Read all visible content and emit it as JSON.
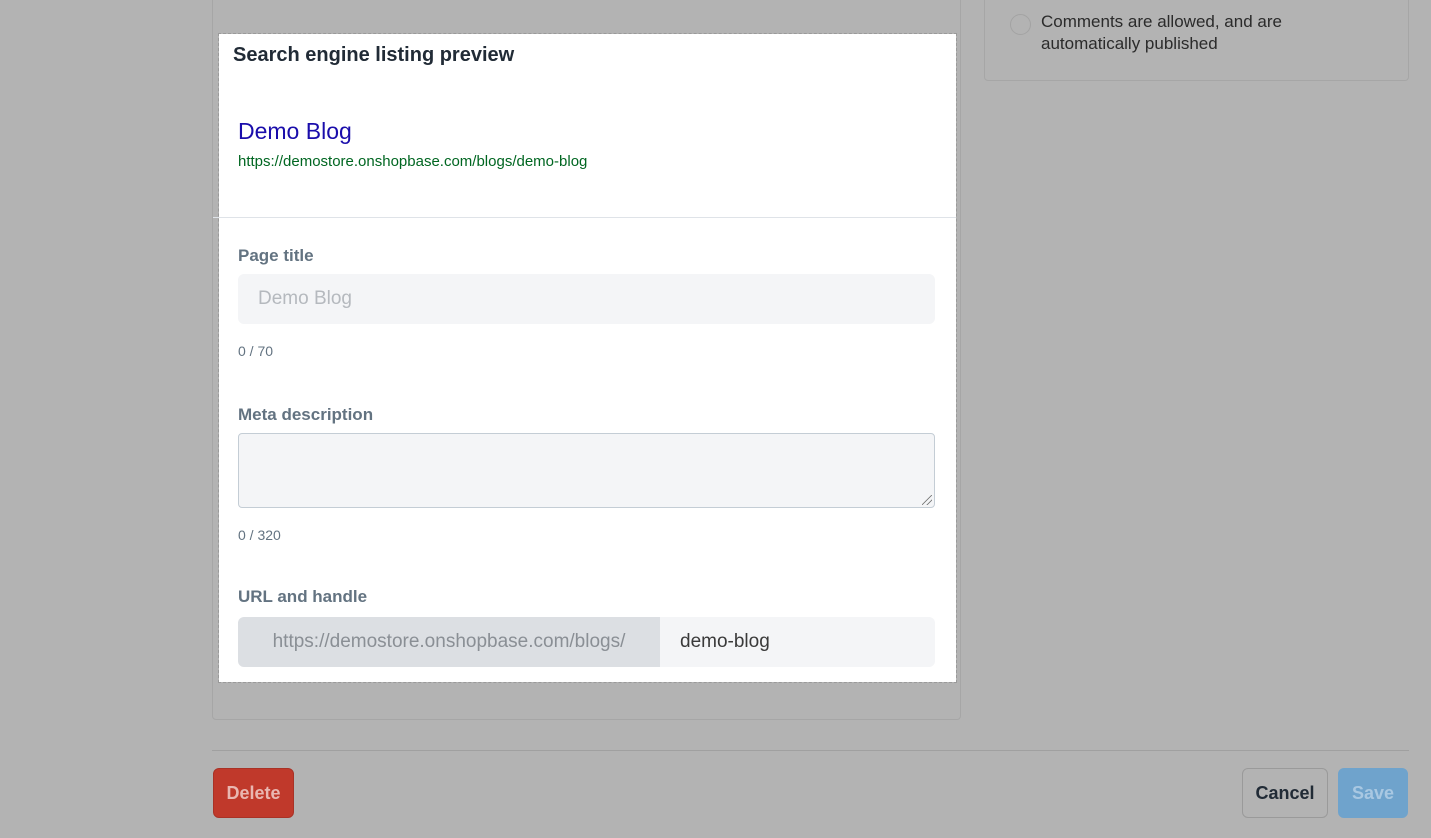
{
  "sidebar": {
    "comment_option_label": "Comments are allowed, and are automatically published"
  },
  "seo": {
    "heading": "Search engine listing preview",
    "preview": {
      "title": "Demo Blog",
      "url": "https://demostore.onshopbase.com/blogs/demo-blog"
    },
    "page_title": {
      "label": "Page title",
      "placeholder": "Demo Blog",
      "counter": "0 / 70"
    },
    "meta_description": {
      "label": "Meta description",
      "value": "",
      "counter": "0 / 320"
    },
    "url_handle": {
      "label": "URL and handle",
      "prefix": "https://demostore.onshopbase.com/blogs/",
      "value": "demo-blog"
    }
  },
  "actions": {
    "delete_label": "Delete",
    "cancel_label": "Cancel",
    "save_label": "Save"
  },
  "colors": {
    "overlay": "#b3b3b3",
    "link_title": "#1a0dab",
    "link_url": "#006621",
    "delete": "#c0392b",
    "save": "#6fa3cc"
  }
}
